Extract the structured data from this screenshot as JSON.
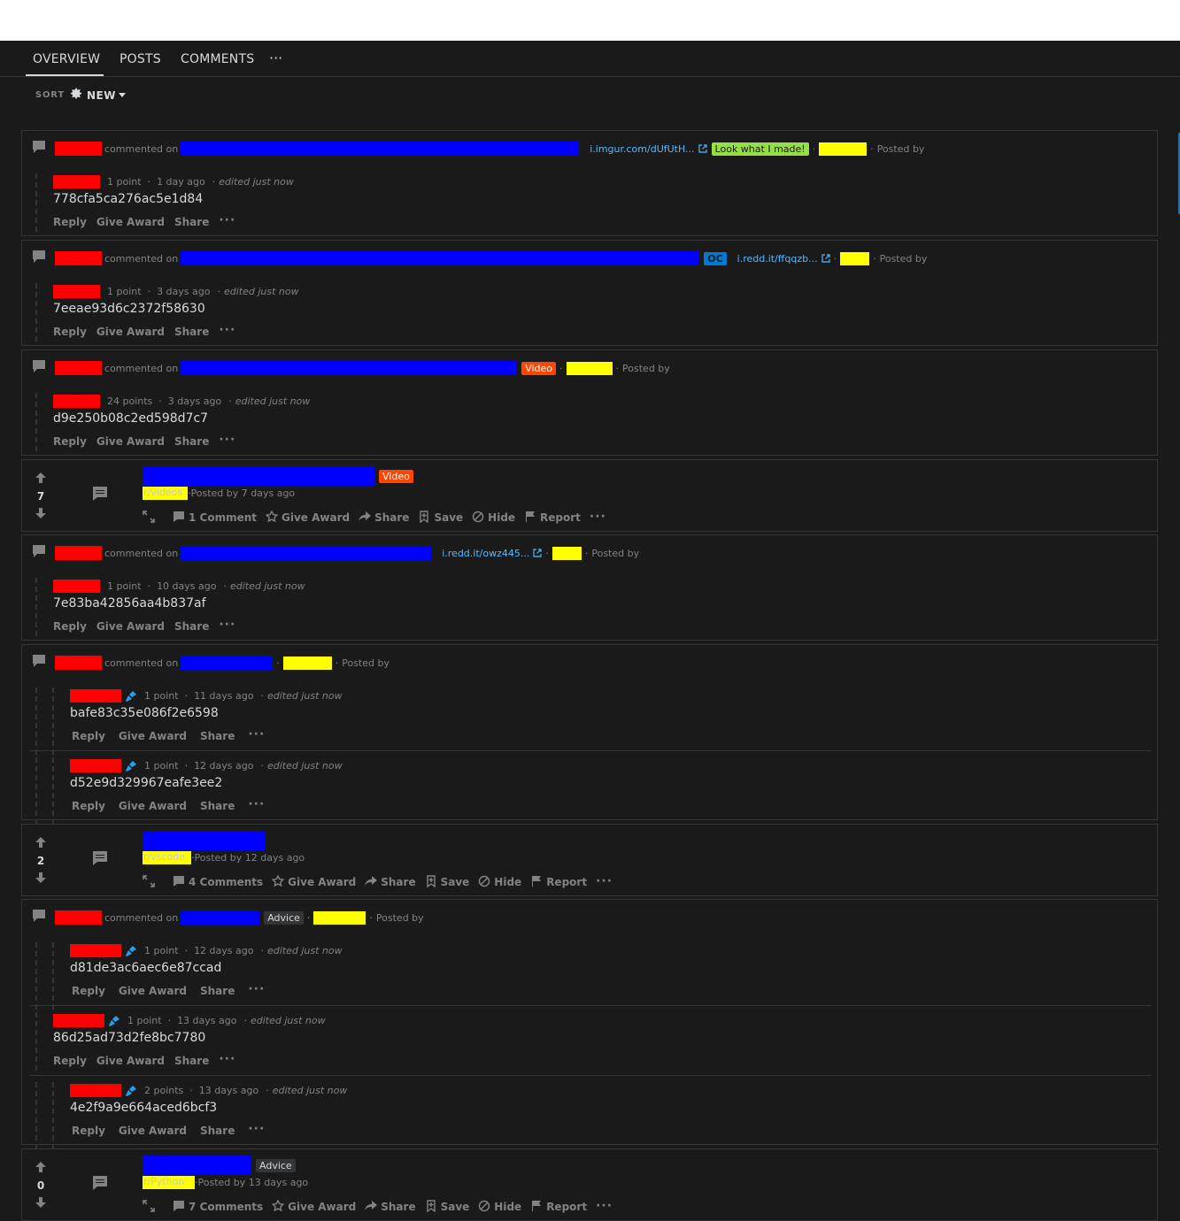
{
  "tabs": [
    {
      "label": "OVERVIEW",
      "active": true
    },
    {
      "label": "POSTS"
    },
    {
      "label": "COMMENTS"
    }
  ],
  "tabs_more": "···",
  "sort": {
    "label": "SORT",
    "value": "NEW"
  },
  "strings": {
    "commented_on": "commented on",
    "posted_by": "Posted by",
    "edited": "edited just now",
    "reply": "Reply",
    "give_award": "Give Award",
    "share": "Share",
    "save": "Save",
    "hide": "Hide",
    "report": "Report",
    "more": "···",
    "dot": "·"
  },
  "items": [
    {
      "kind": "comment",
      "link": "i.imgur.com/dUfUtH...",
      "flair": "Look what I made!",
      "flair_color": "#94e044",
      "comments": [
        {
          "points": "1 point",
          "age": "1 day ago",
          "body": "778cfa5ca276ac5e1d84"
        }
      ]
    },
    {
      "kind": "comment",
      "flair": "OC",
      "flair_color": "#0079d3",
      "link": "i.redd.it/ffqqzb...",
      "comments": [
        {
          "points": "1 point",
          "age": "3 days ago",
          "body": "7eeae93d6c2372f58630"
        }
      ]
    },
    {
      "kind": "comment",
      "flair": "Video",
      "flair_color": "#ff4500",
      "comments": [
        {
          "points": "24 points",
          "age": "3 days ago",
          "body": "d9e250b08c2ed598d7c7"
        }
      ]
    },
    {
      "kind": "post",
      "score": "7",
      "flair": "Video",
      "posted": "Posted by 7 days ago",
      "comments_label": "1 Comment",
      "sub_hint": "r/videos"
    },
    {
      "kind": "comment",
      "link": "i.redd.it/owz445...",
      "comments": [
        {
          "points": "1 point",
          "age": "10 days ago",
          "body": "7e83ba42856aa4b837af"
        }
      ]
    },
    {
      "kind": "comment",
      "comments": [
        {
          "points": "1 point",
          "age": "11 days ago",
          "body": "bafe83c35e086f2e6598"
        },
        {
          "points": "1 point",
          "age": "12 days ago",
          "body": "d52e9d329967eafe3ee2"
        }
      ]
    },
    {
      "kind": "post",
      "score": "2",
      "posted": "Posted by 12 days ago",
      "comments_label": "4 Comments",
      "sub_hint": "r/vscode"
    },
    {
      "kind": "comment",
      "flair": "Advice",
      "flair_color": "#343536",
      "comments": [
        {
          "points": "1 point",
          "age": "12 days ago",
          "body": "d81de3ac6aec6e87ccad"
        },
        {
          "points": "1 point",
          "age": "13 days ago",
          "body": "86d25ad73d2fe8bc7780"
        },
        {
          "points": "2 points",
          "age": "13 days ago",
          "body": "4e2f9a9e664aced6bcf3"
        }
      ]
    },
    {
      "kind": "post",
      "score": "0",
      "flair": "Advice",
      "posted": "Posted by 13 days ago",
      "comments_label": "7 Comments",
      "sub_hint": "r/Python"
    }
  ]
}
